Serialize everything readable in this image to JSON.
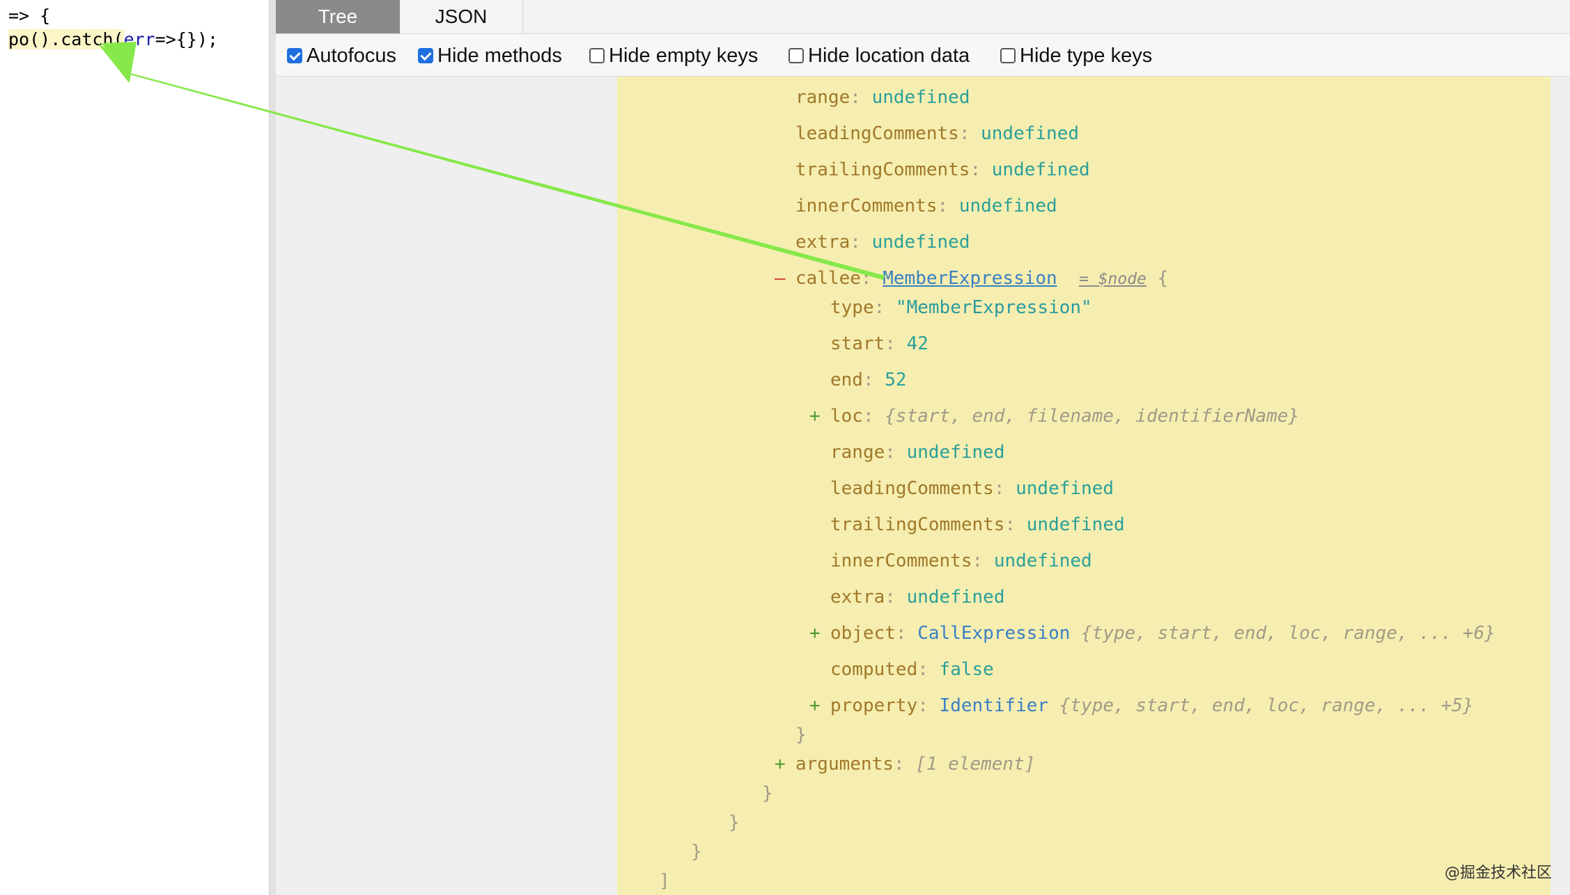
{
  "editor": {
    "line1": "=> {",
    "line2_part_a": "po().catch(",
    "line2_part_b": "err",
    "line2_part_c": "=>{});"
  },
  "tabs": [
    {
      "label": "Tree",
      "active": true
    },
    {
      "label": "JSON",
      "active": false
    }
  ],
  "options": [
    {
      "label": "Autofocus",
      "checked": true
    },
    {
      "label": "Hide methods",
      "checked": true
    },
    {
      "label": "Hide empty keys",
      "checked": false
    },
    {
      "label": "Hide location data",
      "checked": false
    },
    {
      "label": "Hide type keys",
      "checked": false
    }
  ],
  "tree": {
    "outer": [
      {
        "key": "range",
        "value": "undefined"
      },
      {
        "key": "leadingComments",
        "value": "undefined"
      },
      {
        "key": "trailingComments",
        "value": "undefined"
      },
      {
        "key": "innerComments",
        "value": "undefined"
      },
      {
        "key": "extra",
        "value": "undefined"
      }
    ],
    "callee": {
      "toggle": "–",
      "key": "callee",
      "type": "MemberExpression",
      "meta": "= $node",
      "open_brace": "{",
      "fields": {
        "type_key": "type",
        "type_value": "\"MemberExpression\"",
        "start_key": "start",
        "start_value": "42",
        "end_key": "end",
        "end_value": "52",
        "loc_key": "loc",
        "loc_summary": "{start, end, filename, identifierName}",
        "range_key": "range",
        "range_value": "undefined",
        "leading_key": "leadingComments",
        "leading_value": "undefined",
        "trailing_key": "trailingComments",
        "trailing_value": "undefined",
        "inner_key": "innerComments",
        "inner_value": "undefined",
        "extra_key": "extra",
        "extra_value": "undefined",
        "object_key": "object",
        "object_type": "CallExpression",
        "object_summary": "{type, start, end, loc, range, ... +6}",
        "computed_key": "computed",
        "computed_value": "false",
        "property_key": "property",
        "property_type": "Identifier",
        "property_summary": "{type, start, end, loc, range, ... +5}"
      },
      "close_brace": "}"
    },
    "arguments": {
      "key": "arguments",
      "summary": "[1 element]"
    },
    "close_braces": [
      "}",
      "}",
      "}"
    ],
    "close_bracket": "]"
  },
  "expand_toggle": "+",
  "colon": ":",
  "watermark": "@掘金技术社区",
  "colors": {
    "highlight": "#f6eeb0",
    "arrow": "#86e84a",
    "checkbox": "#1f6fe0"
  }
}
